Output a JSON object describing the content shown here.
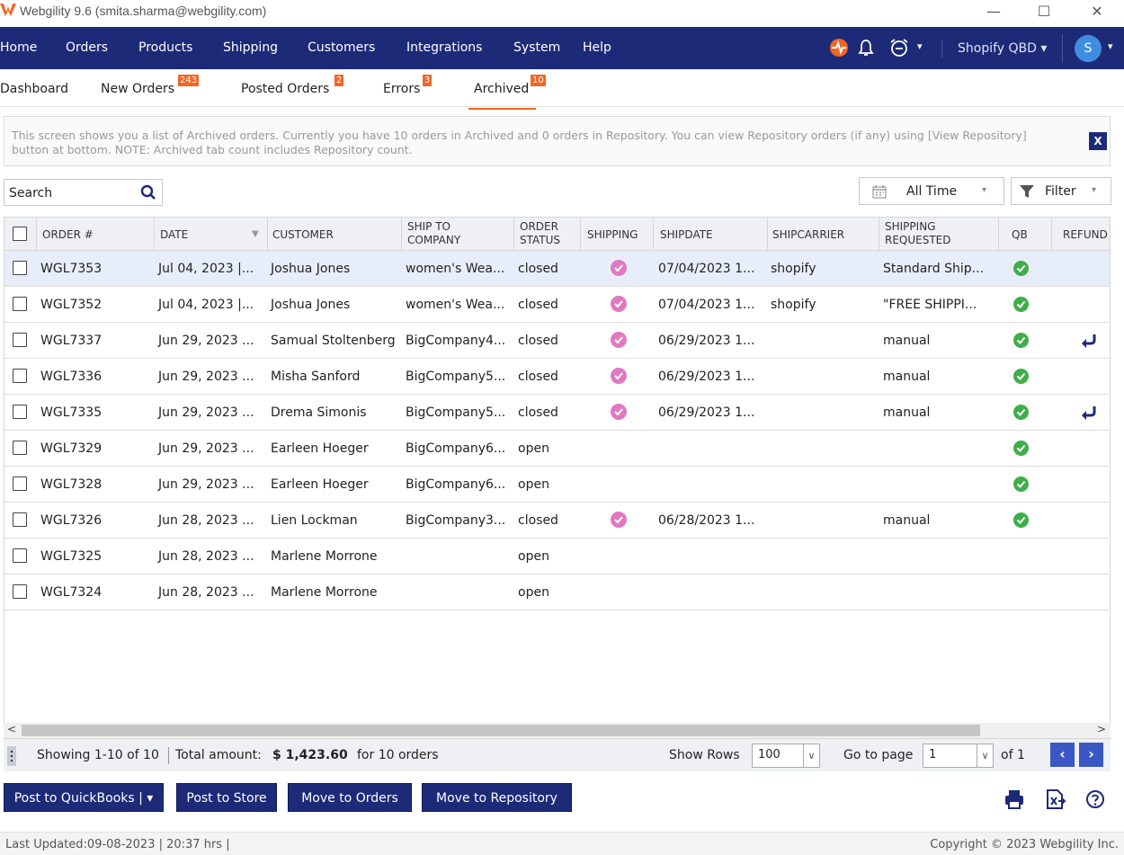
{
  "window": {
    "title": "Webgility 9.6 (smita.sharma@webgility.com)",
    "minimize": "—",
    "maximize": "☐",
    "close": "✕"
  },
  "nav": {
    "items": [
      "Home",
      "Orders",
      "Products",
      "Shipping",
      "Customers",
      "Integrations",
      "System",
      "Help"
    ],
    "store": "Shopify QBD ▾",
    "avatar": "S",
    "avatar_caret": "▾",
    "clock_caret": "▾"
  },
  "tabs": [
    {
      "label": "Dashboard",
      "badge": ""
    },
    {
      "label": "New Orders",
      "badge": "243"
    },
    {
      "label": "Posted Orders",
      "badge": "2"
    },
    {
      "label": "Errors",
      "badge": "3"
    },
    {
      "label": "Archived",
      "badge": "10"
    }
  ],
  "info": {
    "text": "This screen shows you a list of Archived orders. Currently you have 10 orders in Archived and 0 orders in Repository. You can view Repository orders (if any) using [View Repository] button at bottom. NOTE: Archived tab count includes Repository count.",
    "close": "X"
  },
  "search": {
    "placeholder": "Search"
  },
  "date_filter": {
    "label": "All Time",
    "caret": "▾"
  },
  "filter": {
    "label": "Filter",
    "caret": "▾"
  },
  "columns": {
    "order": "ORDER #",
    "date": "DATE",
    "customer": "CUSTOMER",
    "ship_to_1": "SHIP TO",
    "ship_to_2": "COMPANY",
    "status_1": "ORDER",
    "status_2": "STATUS",
    "shipping": "SHIPPING",
    "shipdate": "SHIPDATE",
    "shipcarrier": "SHIPCARRIER",
    "requested_1": "SHIPPING",
    "requested_2": "REQUESTED",
    "qb": "QB",
    "refund": "REFUND"
  },
  "rows": [
    {
      "order": "WGL7353",
      "date": "Jul 04, 2023 |...",
      "customer": "Joshua Jones",
      "company": "women's Wea...",
      "status": "closed",
      "shipping": true,
      "shipdate": "07/04/2023 1...",
      "carrier": "shopify",
      "requested": "Standard Ship...",
      "qb": true,
      "refund": false
    },
    {
      "order": "WGL7352",
      "date": "Jul 04, 2023 |...",
      "customer": "Joshua Jones",
      "company": "women's Wea...",
      "status": "closed",
      "shipping": true,
      "shipdate": "07/04/2023 1...",
      "carrier": "shopify",
      "requested": "\"FREE SHIPPI...",
      "qb": true,
      "refund": false
    },
    {
      "order": "WGL7337",
      "date": "Jun 29, 2023 ...",
      "customer": "Samual Stoltenberg",
      "company": "BigCompany4...",
      "status": "closed",
      "shipping": true,
      "shipdate": "06/29/2023 1...",
      "carrier": "",
      "requested": "manual",
      "qb": true,
      "refund": true
    },
    {
      "order": "WGL7336",
      "date": "Jun 29, 2023 ...",
      "customer": "Misha Sanford",
      "company": "BigCompany5...",
      "status": "closed",
      "shipping": true,
      "shipdate": "06/29/2023 1...",
      "carrier": "",
      "requested": "manual",
      "qb": true,
      "refund": false
    },
    {
      "order": "WGL7335",
      "date": "Jun 29, 2023 ...",
      "customer": "Drema Simonis",
      "company": "BigCompany5...",
      "status": "closed",
      "shipping": true,
      "shipdate": "06/29/2023 1...",
      "carrier": "",
      "requested": "manual",
      "qb": true,
      "refund": true
    },
    {
      "order": "WGL7329",
      "date": "Jun 29, 2023 ...",
      "customer": "Earleen Hoeger",
      "company": "BigCompany6...",
      "status": "open",
      "shipping": false,
      "shipdate": "",
      "carrier": "",
      "requested": "",
      "qb": true,
      "refund": false
    },
    {
      "order": "WGL7328",
      "date": "Jun 29, 2023 ...",
      "customer": "Earleen Hoeger",
      "company": "BigCompany6...",
      "status": "open",
      "shipping": false,
      "shipdate": "",
      "carrier": "",
      "requested": "",
      "qb": true,
      "refund": false
    },
    {
      "order": "WGL7326",
      "date": "Jun 28, 2023 ...",
      "customer": "Lien Lockman",
      "company": "BigCompany3...",
      "status": "closed",
      "shipping": true,
      "shipdate": "06/28/2023 1...",
      "carrier": "",
      "requested": "manual",
      "qb": true,
      "refund": false
    },
    {
      "order": "WGL7325",
      "date": "Jun 28, 2023 ...",
      "customer": "Marlene Morrone",
      "company": "",
      "status": "open",
      "shipping": false,
      "shipdate": "",
      "carrier": "",
      "requested": "",
      "qb": false,
      "refund": false
    },
    {
      "order": "WGL7324",
      "date": "Jun 28, 2023 ...",
      "customer": "Marlene Morrone",
      "company": "",
      "status": "open",
      "shipping": false,
      "shipdate": "",
      "carrier": "",
      "requested": "",
      "qb": false,
      "refund": false
    }
  ],
  "scroll": {
    "left": "<",
    "right": ">"
  },
  "footer": {
    "showing": "Showing 1-10 of 10",
    "total_label": "Total amount:",
    "total_value": "$ 1,423.60",
    "total_suffix": "for 10 orders",
    "show_rows_label": "Show Rows",
    "show_rows_value": "100",
    "goto_label": "Go to page",
    "goto_value": "1",
    "of_pages": "of 1",
    "dropdown_caret": "∨",
    "prev": "‹",
    "next": "›"
  },
  "actions": {
    "post_qb": "Post to QuickBooks | ▾",
    "post_store": "Post to Store",
    "move_orders": "Move to Orders",
    "move_repo": "Move to Repository"
  },
  "status": {
    "last_updated": "Last Updated:09-08-2023 | 20:37 hrs |",
    "copyright": "Copyright © 2023 Webgility Inc."
  },
  "colors": {
    "nav_bg": "#1c2a78",
    "badge": "#f26522",
    "shipping_dot": "#e07ac0",
    "qb_dot": "#3fae49",
    "pager": "#3a57c4"
  }
}
